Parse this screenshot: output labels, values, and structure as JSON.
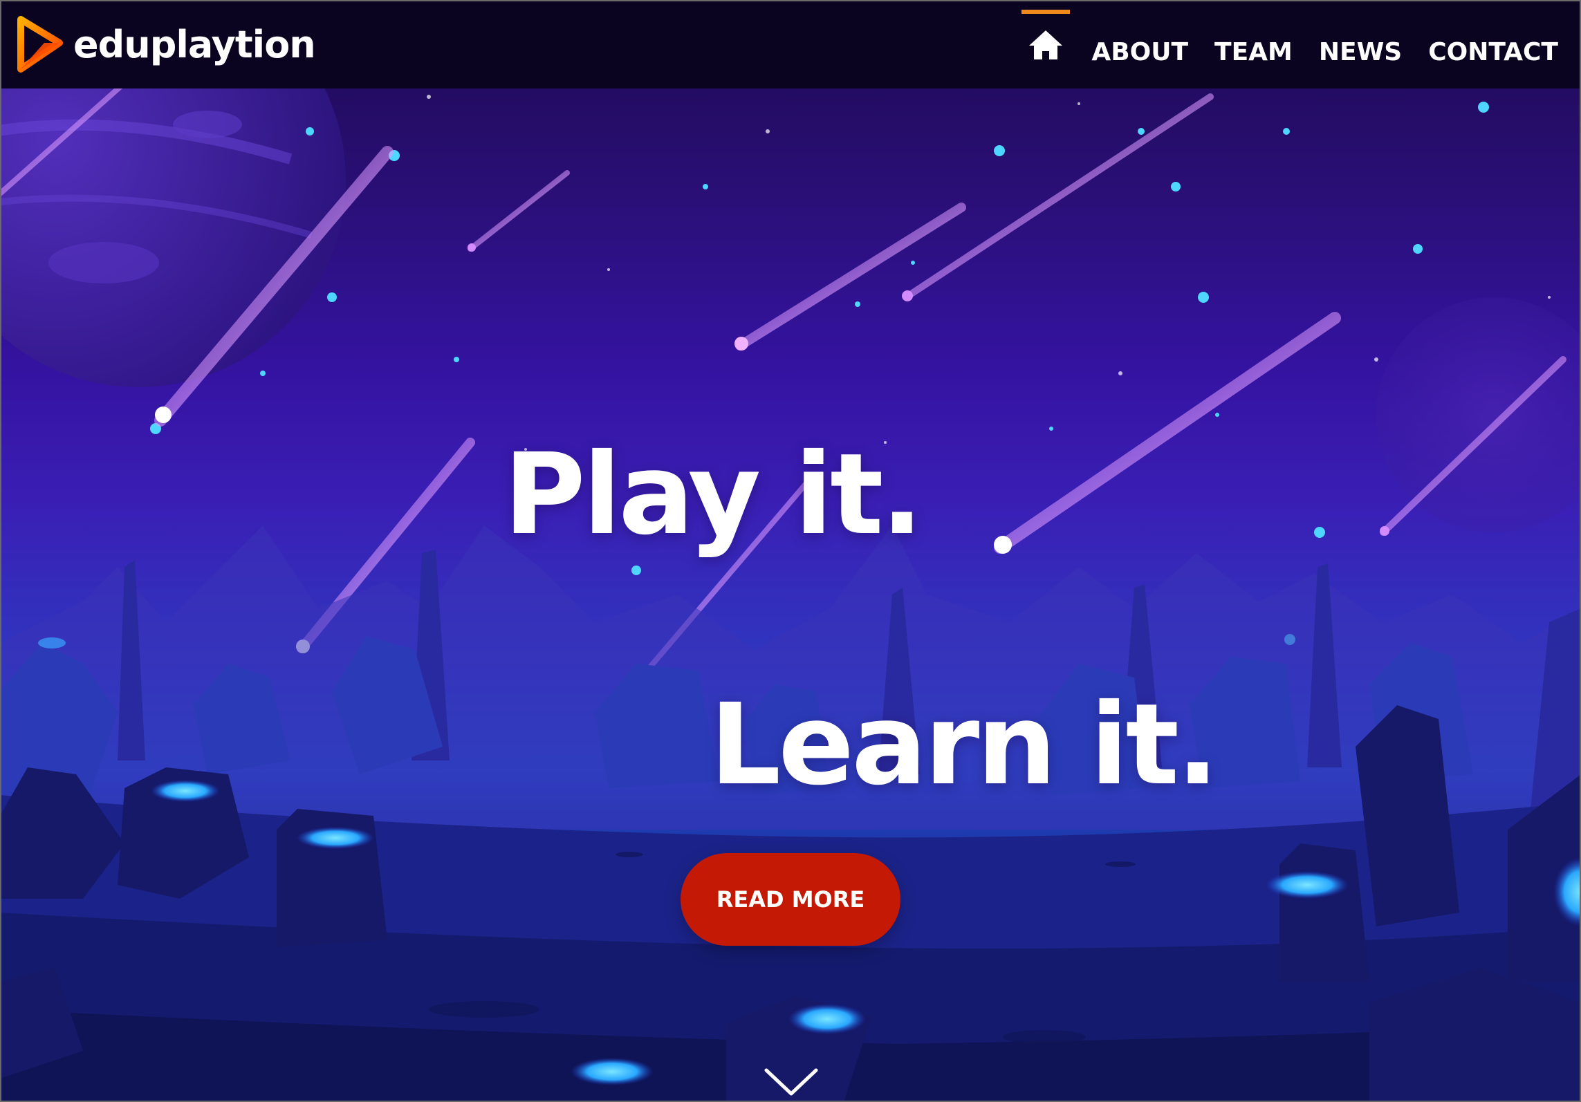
{
  "brand": {
    "name": "eduplaytion",
    "logo_icon": "play-triangle-logo-icon"
  },
  "nav": {
    "home_icon": "home-icon",
    "items": [
      {
        "label": "ABOUT"
      },
      {
        "label": "TEAM"
      },
      {
        "label": "NEWS"
      },
      {
        "label": "CONTACT"
      }
    ]
  },
  "hero": {
    "headline_1": "Play it.",
    "headline_2": "Learn it.",
    "cta_label": "READ MORE",
    "scroll_icon": "chevron-down-icon"
  },
  "colors": {
    "accent_orange": "#f08a1c",
    "cta_red": "#c41a05",
    "navbar_bg": "#0a0420",
    "sky_top": "#1d0a52",
    "sky_mid": "#3a1fb5",
    "ground": "#0c0f3e"
  }
}
